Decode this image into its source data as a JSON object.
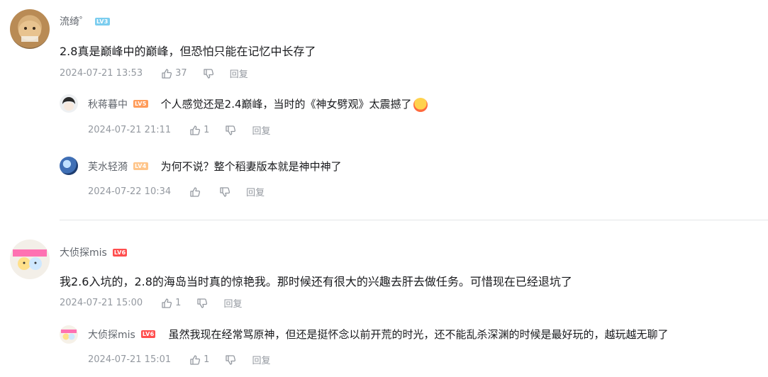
{
  "comments": [
    {
      "user": "流绮゜",
      "level": "LV3",
      "content": "2.8真是巅峰中的巅峰，但恐怕只能在记忆中长存了",
      "time": "2024-07-21 13:53",
      "likes": "37",
      "reply_label": "回复",
      "replies": [
        {
          "user": "秋蒋暮中",
          "level": "LV5",
          "content": "个人感觉还是2.4巅峰，当时的《神女劈观》太震撼了",
          "emoji": "crying-emoji-icon",
          "time": "2024-07-21 21:11",
          "likes": "1",
          "reply_label": "回复"
        },
        {
          "user": "芙水轻漪",
          "level": "LV4",
          "content": "为何不说？整个稻妻版本就是神中神了",
          "time": "2024-07-22 10:34",
          "likes": "",
          "reply_label": "回复"
        }
      ]
    },
    {
      "user": "大侦探mis",
      "level": "LV6",
      "content": "我2.6入坑的，2.8的海岛当时真的惊艳我。那时候还有很大的兴趣去肝去做任务。可惜现在已经退坑了",
      "time": "2024-07-21 15:00",
      "likes": "1",
      "reply_label": "回复",
      "replies": [
        {
          "user": "大侦探mis",
          "level": "LV6",
          "content": "虽然我现在经常骂原神，但还是挺怀念以前开荒的时光，还不能乱杀深渊的时候是最好玩的，越玩越无聊了",
          "time": "2024-07-21 15:01",
          "likes": "1",
          "reply_label": "回复"
        }
      ]
    }
  ],
  "colors": {
    "text": "#18191c",
    "name": "#61666d",
    "meta": "#9499a0",
    "lv3": "#7bcdef",
    "lv5": "#ff9c5a",
    "lv6": "#ff4e4e",
    "divider": "#e3e5e7"
  }
}
